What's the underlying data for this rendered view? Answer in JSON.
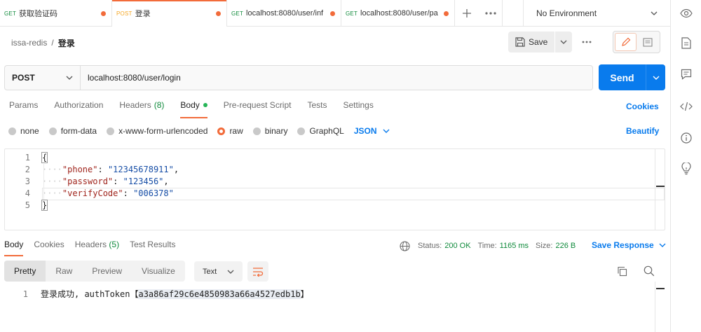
{
  "tabs": [
    {
      "method": "GET",
      "name": "获取验证码",
      "active": false
    },
    {
      "method": "POST",
      "name": "登录",
      "active": true
    },
    {
      "method": "GET",
      "name": "localhost:8080/user/inf",
      "active": false
    },
    {
      "method": "GET",
      "name": "localhost:8080/user/pa",
      "active": false
    }
  ],
  "environment": "No Environment",
  "breadcrumb": {
    "collection": "issa-redis",
    "separator": "/",
    "request": "登录"
  },
  "toolbar": {
    "save_label": "Save"
  },
  "request": {
    "method": "POST",
    "url": "localhost:8080/user/login",
    "send_label": "Send"
  },
  "request_tabs": {
    "params": "Params",
    "authorization": "Authorization",
    "headers": "Headers",
    "headers_count": "(8)",
    "body": "Body",
    "prerequest": "Pre-request Script",
    "tests": "Tests",
    "settings": "Settings",
    "cookies": "Cookies"
  },
  "body_types": {
    "none": "none",
    "form_data": "form-data",
    "urlencoded": "x-www-form-urlencoded",
    "raw": "raw",
    "binary": "binary",
    "graphql": "GraphQL",
    "language": "JSON",
    "beautify": "Beautify"
  },
  "editor": {
    "line_numbers": [
      "1",
      "2",
      "3",
      "4",
      "5"
    ],
    "open_brace": "{",
    "close_brace": "}",
    "fields": [
      {
        "key": "\"phone\"",
        "value": "\"12345678911\"",
        "trail": ","
      },
      {
        "key": "\"password\"",
        "value": "\"123456\"",
        "trail": ","
      },
      {
        "key": "\"verifyCode\"",
        "value": "\"006378\"",
        "trail": ""
      }
    ]
  },
  "response": {
    "tabs": {
      "body": "Body",
      "cookies": "Cookies",
      "headers": "Headers",
      "headers_count": "(5)",
      "tests": "Test Results"
    },
    "status_label": "Status:",
    "status_value": "200 OK",
    "time_label": "Time:",
    "time_value": "1165 ms",
    "size_label": "Size:",
    "size_value": "226 B",
    "save_response": "Save Response",
    "views": {
      "pretty": "Pretty",
      "raw": "Raw",
      "preview": "Preview",
      "visualize": "Visualize"
    },
    "format": "Text",
    "line_numbers": [
      "1"
    ],
    "body_prefix": "登录成功, authToken【",
    "body_token": "a3a86af29c6e4850983a66a4527edb1b",
    "body_suffix": "】"
  },
  "colors": {
    "accent": "#f26b3a",
    "primary": "#097bed",
    "success": "#0f8a3b"
  }
}
